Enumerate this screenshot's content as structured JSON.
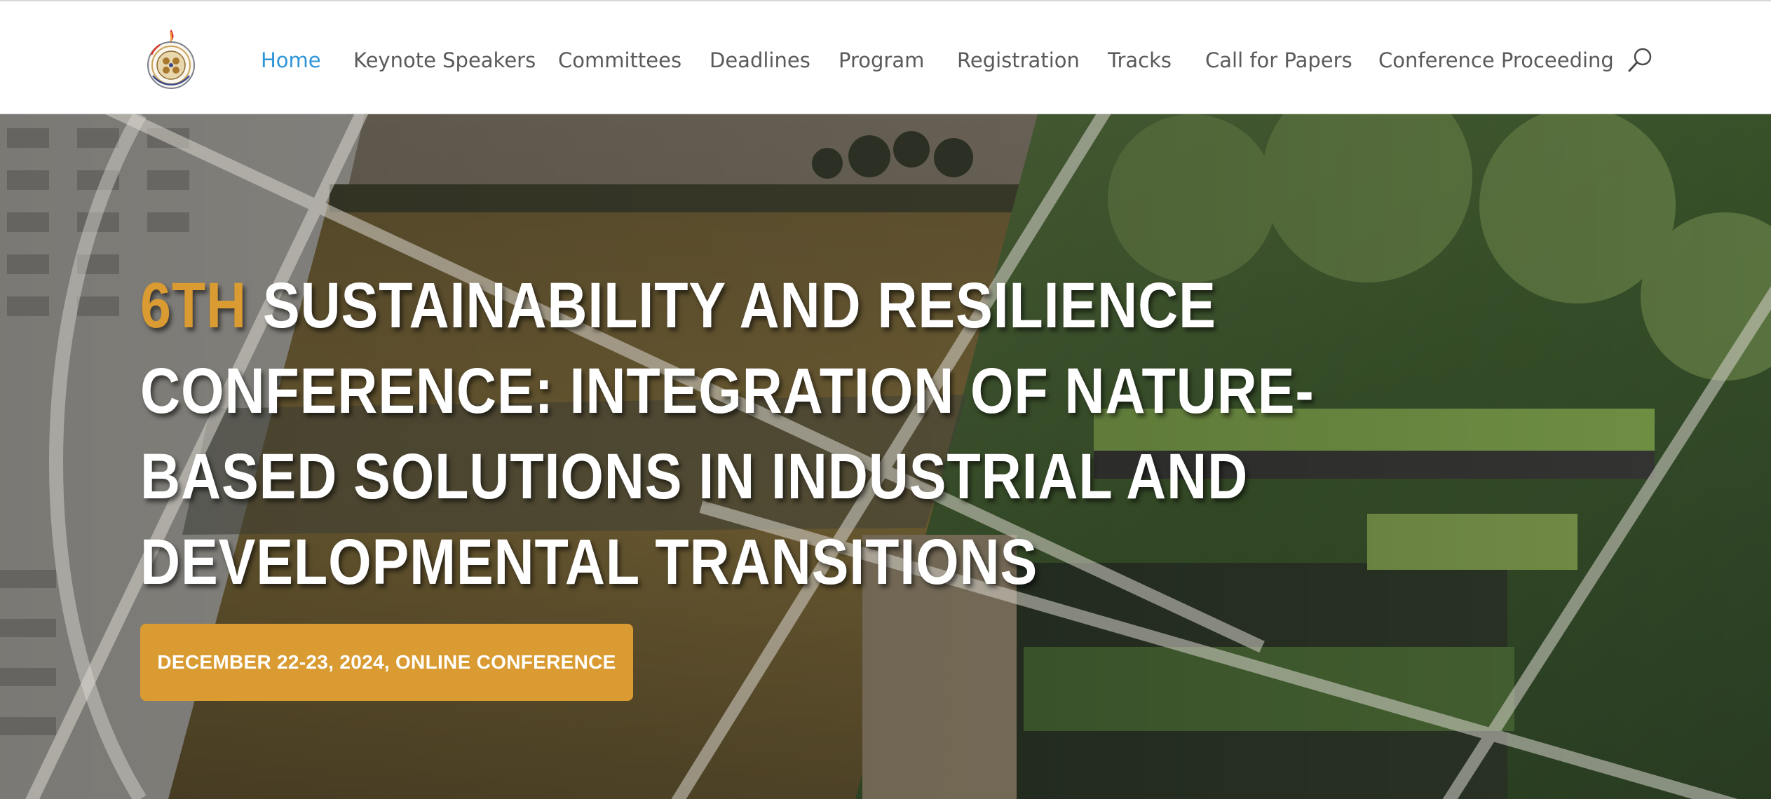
{
  "header": {
    "logo_icon": "conference-seal-logo-icon",
    "nav": [
      {
        "label": "Home",
        "active": true
      },
      {
        "label": "Keynote Speakers",
        "active": false
      },
      {
        "label": "Committees",
        "active": false
      },
      {
        "label": "Deadlines",
        "active": false
      },
      {
        "label": "Program",
        "active": false
      },
      {
        "label": "Registration",
        "active": false
      },
      {
        "label": "Tracks",
        "active": false
      },
      {
        "label": "Call for Papers",
        "active": false
      },
      {
        "label": "Conference Proceeding",
        "active": false
      }
    ],
    "search_icon": "search-icon"
  },
  "hero": {
    "title_accent": "6TH",
    "title_rest": " SUSTAINABILITY AND RESILIENCE CONFERENCE: INTEGRATION OF NATURE-BASED SOLUTIONS IN INDUSTRIAL AND DEVELOPMENTAL TRANSITIONS",
    "cta_label": "DECEMBER 22-23, 2024, ONLINE CONFERENCE"
  },
  "colors": {
    "accent": "#d99b32",
    "nav_active": "#2e95d8",
    "nav_text": "#5a5a5a",
    "title_text": "#ffffff"
  }
}
